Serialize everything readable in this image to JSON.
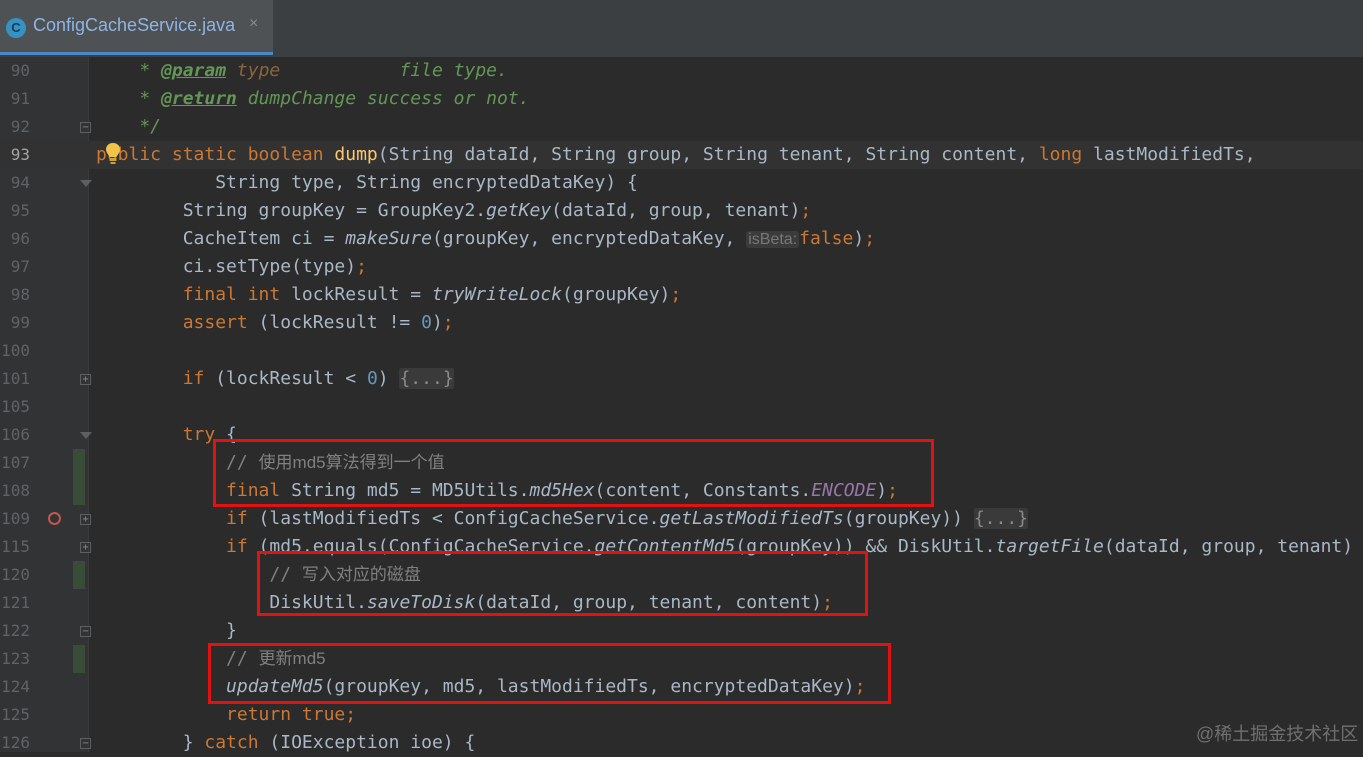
{
  "tab": {
    "title": "ConfigCacheService.java",
    "icon_letter": "C",
    "close_glyph": "×"
  },
  "inlay_hint": {
    "is_beta": "isBeta:"
  },
  "folded_block": "{...}",
  "watermark": "@稀土掘金技术社区",
  "current_line": "93",
  "line_numbers": {
    "l90": "90",
    "l91": "91",
    "l92": "92",
    "l93": "93",
    "l94": "94",
    "l95": "95",
    "l96": "96",
    "l97": "97",
    "l98": "98",
    "l99": "99",
    "l100": "100",
    "l101": "101",
    "l105": "105",
    "l106": "106",
    "l107": "107",
    "l108": "108",
    "l109": "109",
    "l115": "115",
    "l120": "120",
    "l121": "121",
    "l122": "122",
    "l123": "123",
    "l124": "124",
    "l125": "125",
    "l126": "126"
  },
  "tokens": {
    "t90_star": "    * ",
    "t90_tag": "@param",
    "t90_sp": " ",
    "t90_val": "type",
    "t90_desc": "           file type.",
    "t91_star": "    * ",
    "t91_tag": "@return",
    "t91_desc": " dumpChange success or not.",
    "t92": "    */",
    "t93_kw": "public static boolean ",
    "t93_fn": "dump",
    "t93_a": "(String dataId, String group, String tenant, String content, ",
    "t93_kw2": "long",
    "t93_b": " lastModifiedTs,",
    "t94": "           String type, String encryptedDataKey) {",
    "t95_a": "        String groupKey = GroupKey2.",
    "t95_it": "getKey",
    "t95_b": "(dataId, group, tenant)",
    "t95_semi": ";",
    "t96_a": "        CacheItem ci = ",
    "t96_it": "makeSure",
    "t96_b": "(groupKey, encryptedDataKey, ",
    "t96_kw": "false",
    "t96_c": ")",
    "t96_semi": ";",
    "t97_a": "        ci.setType(type)",
    "t97_semi": ";",
    "t98_kw": "        final int",
    "t98_a": " lockResult = ",
    "t98_it": "tryWriteLock",
    "t98_b": "(groupKey)",
    "t98_semi": ";",
    "t99_kw": "        assert",
    "t99_a": " (lockResult != ",
    "t99_num": "0",
    "t99_b": ")",
    "t99_semi": ";",
    "t101_kw": "        if",
    "t101_a": " (lockResult < ",
    "t101_num": "0",
    "t101_b": ") ",
    "t106_kw": "        try",
    "t106_a": " {",
    "t107_c1": "            // ",
    "t107_cn": "使用md5算法得到一个值",
    "t108_kw": "            final",
    "t108_a": " String md5 = MD5Utils.",
    "t108_it": "md5Hex",
    "t108_b": "(content, Constants.",
    "t108_cst": "ENCODE",
    "t108_c": ")",
    "t108_semi": ";",
    "t109_kw": "            if",
    "t109_a": " (lastModifiedTs < ConfigCacheService.",
    "t109_it": "getLastModifiedTs",
    "t109_b": "(groupKey)) ",
    "t115_kw": "            if",
    "t115_a": " (md5.equals(ConfigCacheService.",
    "t115_it": "getContentMd5",
    "t115_b": "(groupKey)) && DiskUtil.",
    "t115_it2": "targetFile",
    "t115_c": "(dataId, group, tenant)",
    "t120_c1": "                // ",
    "t120_cn": "写入对应的磁盘",
    "t121_a": "                DiskUtil.",
    "t121_it": "saveToDisk",
    "t121_b": "(dataId, group, tenant, content)",
    "t121_semi": ";",
    "t122": "            }",
    "t123_c1": "            // ",
    "t123_cn": "更新md5",
    "t124_it": "            updateMd5",
    "t124_a": "(groupKey, md5, lastModifiedTs, encryptedDataKey)",
    "t124_semi": ";",
    "t125_kw": "            return true",
    "t125_semi": ";",
    "t126_a": "        } ",
    "t126_kw": "catch",
    "t126_b": " (IOException ioe) {"
  },
  "colors": {
    "keyword": "#cc7832",
    "method_decl": "#ffc66d",
    "number": "#6897bb",
    "constant": "#9876aa",
    "doc_comment": "#629755",
    "comment": "#808080",
    "highlight_box": "#e01212"
  }
}
